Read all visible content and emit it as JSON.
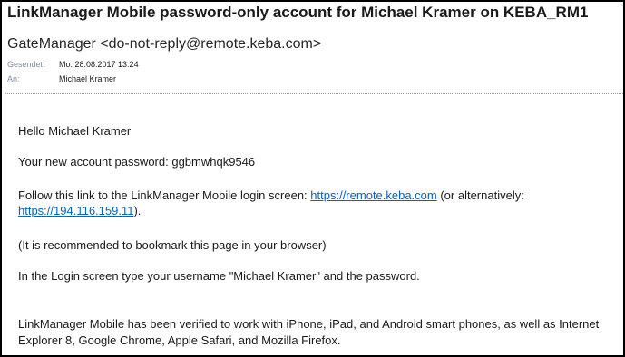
{
  "email": {
    "subject": "LinkManager Mobile password-only account for Michael Kramer on KEBA_RM1",
    "sender": "GateManager <do-not-reply@remote.keba.com>",
    "sent_label": "Gesendet:",
    "sent_value": "Mo. 28.08.2017 13:24",
    "to_label": "An:",
    "to_value": "Michael Kramer"
  },
  "body": {
    "greeting": "Hello Michael Kramer",
    "password_line": "Your new account password: ggbmwhqk9546",
    "follow_prefix": "Follow this link to the LinkManager Mobile login screen: ",
    "link1": "https://remote.keba.com",
    "follow_middle": " (or alternatively:",
    "link2": "https://194.116.159.11",
    "follow_suffix": ").",
    "recommend": "(It is recommended to bookmark this page in your browser)",
    "login_instructions": "In the Login screen type your username \"Michael Kramer\" and the password.",
    "verified_line1": "LinkManager Mobile has been verified to work with iPhone, iPad, and Android smart phones, as well as Internet",
    "verified_line2": "Explorer 8, Google Chrome, Apple Safari, and Mozilla Firefox."
  }
}
